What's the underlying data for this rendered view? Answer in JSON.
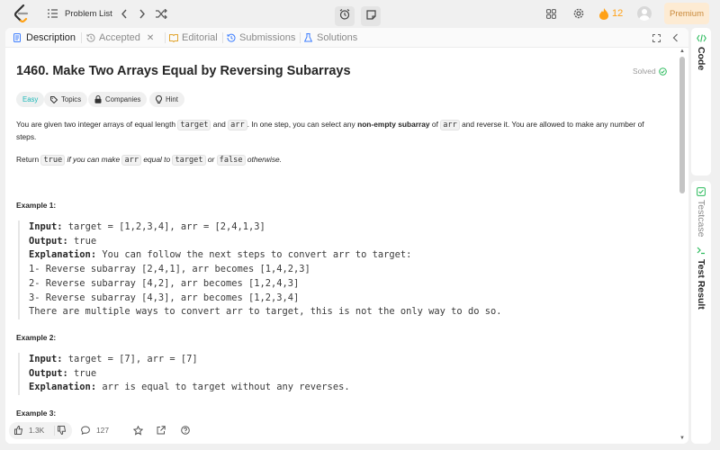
{
  "nav": {
    "problem_list": "Problem List",
    "streak": "12",
    "premium": "Premium"
  },
  "tabs": [
    {
      "label": "Description"
    },
    {
      "label": "Accepted"
    },
    {
      "label": "Editorial"
    },
    {
      "label": "Submissions"
    },
    {
      "label": "Solutions"
    }
  ],
  "problem": {
    "title": "1460. Make Two Arrays Equal by Reversing Subarrays",
    "status": "Solved",
    "tags": {
      "easy": "Easy",
      "topics": "Topics",
      "companies": "Companies",
      "hint": "Hint"
    },
    "desc": {
      "p1_a": "You are given two integer arrays of equal length ",
      "code_target": "target",
      "p1_and": " and ",
      "code_arr": "arr",
      "p1_b": ". In one step, you can select any ",
      "p1_bold": "non-empty subarray",
      "p1_of": " of ",
      "p1_c": " and reverse it. You are allowed to make any number of",
      "p1_d": "steps.",
      "p2_a": "Return ",
      "code_true": "true",
      "p2_b": " if you can make ",
      "p2_c": " equal to ",
      "p2_or": " or ",
      "code_false": "false",
      "p2_d": " otherwise."
    },
    "examples": [
      {
        "heading": "Example 1:",
        "input_label": "Input:",
        "input": " target = [1,2,3,4], arr = [2,4,1,3]",
        "output_label": "Output:",
        "output": " true",
        "explanation_label": "Explanation:",
        "explanation": " You can follow the next steps to convert arr to target:",
        "lines": [
          "1- Reverse subarray [2,4,1], arr becomes [1,4,2,3]",
          "2- Reverse subarray [4,2], arr becomes [1,2,4,3]",
          "3- Reverse subarray [4,3], arr becomes [1,2,3,4]",
          "There are multiple ways to convert arr to target, this is not the only way to do so."
        ]
      },
      {
        "heading": "Example 2:",
        "input_label": "Input:",
        "input": " target = [7], arr = [7]",
        "output_label": "Output:",
        "output": " true",
        "explanation_label": "Explanation:",
        "explanation": " arr is equal to target without any reverses."
      },
      {
        "heading": "Example 3:"
      }
    ]
  },
  "footer": {
    "likes": "1.3K",
    "comments": "127"
  },
  "side": {
    "code": "Code",
    "testcase": "Testcase",
    "test_result": "Test Result"
  },
  "colors": {
    "accent_green": "#2cbb5d",
    "streak_orange": "#ffa116",
    "easy_teal": "#1cb8b8",
    "premium_text": "#c98a3c"
  }
}
